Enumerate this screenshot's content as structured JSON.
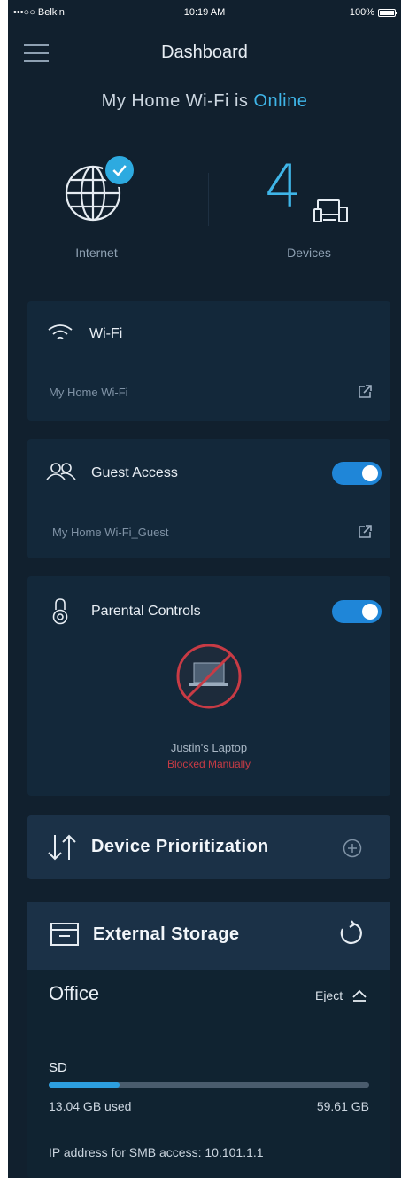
{
  "status_bar": {
    "carrier": "•••○○ Belkin",
    "time": "10:19 AM",
    "battery": "100%"
  },
  "nav": {
    "title": "Dashboard"
  },
  "network": {
    "prefix": "My Home Wi-Fi is ",
    "status": "Online"
  },
  "internet": {
    "label": "Internet"
  },
  "devices": {
    "count": "4",
    "label": "Devices"
  },
  "wifi": {
    "title": "Wi-Fi",
    "network_name": "My Home Wi-Fi"
  },
  "guest": {
    "title": "Guest Access",
    "network_name": "My Home Wi-Fi_Guest",
    "enabled": true
  },
  "parental": {
    "title": "Parental Controls",
    "enabled": true,
    "device_name": "Justin's Laptop",
    "device_status": "Blocked Manually"
  },
  "prioritization": {
    "title": "Device Prioritization"
  },
  "storage": {
    "title": "External Storage",
    "drive_name": "Office",
    "eject_label": "Eject",
    "volume": "SD",
    "used": "13.04 GB used",
    "total": "59.61 GB",
    "used_fraction": 0.22,
    "ip_text": "IP address for SMB access: 10.101.1.1"
  },
  "colors": {
    "accent": "#3fb5e8",
    "toggle_on": "#1f86d8",
    "blocked": "#c83b45",
    "background": "#11202e"
  }
}
